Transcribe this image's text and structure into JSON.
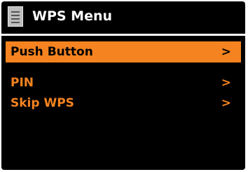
{
  "header": {
    "title": "WPS Menu",
    "icon": "menu-list-icon"
  },
  "colors": {
    "background": "#000000",
    "accent": "#f58320",
    "header_text": "#ffffff",
    "selected_text": "#000000"
  },
  "menu": {
    "items": [
      {
        "label": "Push Button",
        "arrow": ">",
        "selected": true
      },
      {
        "label": "PIN",
        "arrow": ">",
        "selected": false
      },
      {
        "label": "Skip WPS",
        "arrow": ">",
        "selected": false
      }
    ]
  }
}
